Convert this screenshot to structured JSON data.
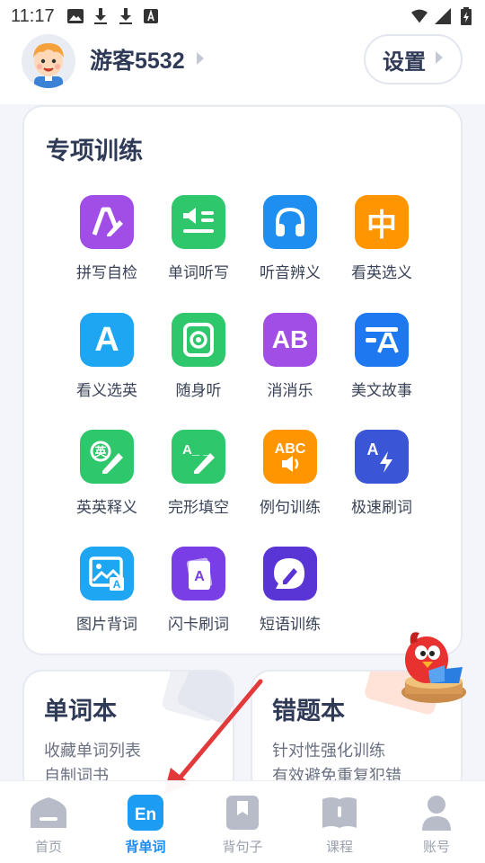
{
  "status_bar": {
    "time": "11:17",
    "left_icons": [
      "image-icon",
      "download-icon",
      "download-icon",
      "font-icon"
    ],
    "right_icons": [
      "wifi-icon",
      "signal-icon",
      "battery-charging-icon"
    ]
  },
  "header": {
    "username": "游客5532",
    "settings_label": "设置"
  },
  "special_training": {
    "title": "专项训练",
    "items": [
      {
        "label": "拼写自检",
        "icon": "spelling-pen-icon",
        "color": "#a04ee6"
      },
      {
        "label": "单词听写",
        "icon": "dictation-icon",
        "color": "#2fc76b"
      },
      {
        "label": "听音辨义",
        "icon": "headphones-icon",
        "color": "#1e8ff0"
      },
      {
        "label": "看英选义",
        "icon": "chinese-char-icon",
        "color": "#ff9500"
      },
      {
        "label": "看义选英",
        "icon": "letter-a-icon",
        "color": "#1ea6f2"
      },
      {
        "label": "随身听",
        "icon": "speaker-icon",
        "color": "#2fc76b"
      },
      {
        "label": "消消乐",
        "icon": "ab-icon",
        "color": "#a04ee6"
      },
      {
        "label": "美文故事",
        "icon": "story-icon",
        "color": "#1e78f0"
      },
      {
        "label": "英英释义",
        "icon": "english-edit-icon",
        "color": "#2fc76b"
      },
      {
        "label": "完形填空",
        "icon": "cloze-icon",
        "color": "#2fc76b"
      },
      {
        "label": "例句训练",
        "icon": "abc-sound-icon",
        "color": "#ff9500"
      },
      {
        "label": "极速刷词",
        "icon": "lightning-icon",
        "color": "#3a55d6"
      },
      {
        "label": "图片背词",
        "icon": "picture-icon",
        "color": "#1ea6f2"
      },
      {
        "label": "闪卡刷词",
        "icon": "flashcard-icon",
        "color": "#7a3ee6"
      },
      {
        "label": "短语训练",
        "icon": "chat-edit-icon",
        "color": "#5a35d6"
      }
    ],
    "icon_text": {
      "chinese": "中",
      "letter_a": "A",
      "ab": "AB",
      "abc": "ABC",
      "ying": "英",
      "cloze": "A_ _"
    }
  },
  "wordbook": {
    "title": "单词本",
    "line1": "收藏单词列表",
    "line2": "自制词书"
  },
  "mistakes": {
    "title": "错题本",
    "line1": "针对性强化训练",
    "line2": "有效避免重复犯错"
  },
  "bottom_nav": {
    "items": [
      {
        "label": "首页",
        "icon": "home-icon",
        "active": false
      },
      {
        "label": "背单词",
        "icon": "en-icon",
        "active": true
      },
      {
        "label": "背句子",
        "icon": "bookmark-icon",
        "active": false
      },
      {
        "label": "课程",
        "icon": "book-icon",
        "active": false
      },
      {
        "label": "账号",
        "icon": "user-icon",
        "active": false
      }
    ],
    "en_text": "En"
  },
  "colors": {
    "accent_blue": "#1c8cf0",
    "title_text": "#2f3a57",
    "annotation_red": "#e23a3a"
  }
}
